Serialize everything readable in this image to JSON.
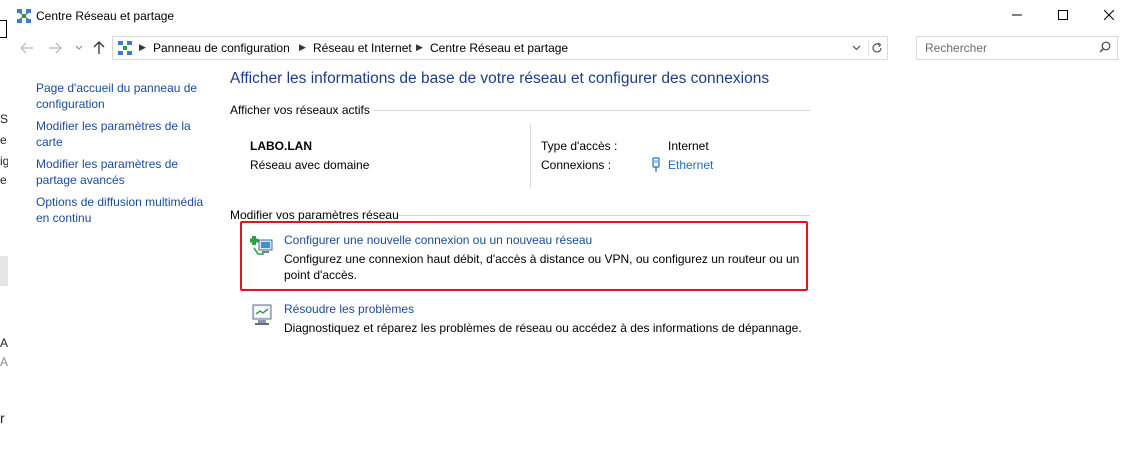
{
  "window": {
    "title": "Centre Réseau et partage",
    "min_icon": "minimize-icon",
    "max_icon": "maximize-icon",
    "close_icon": "close-icon"
  },
  "address": {
    "icon": "control-panel-icon",
    "crumbs": [
      "Panneau de configuration",
      "Réseau et Internet",
      "Centre Réseau et partage"
    ],
    "search_placeholder": "Rechercher"
  },
  "background_fragments": [
    "S",
    "e",
    "ig",
    "e",
    "A",
    "A",
    "r"
  ],
  "sidebar": {
    "items": [
      {
        "label": "Page d'accueil du panneau de configuration"
      },
      {
        "label": "Modifier les paramètres de la carte"
      },
      {
        "label": "Modifier les paramètres de partage avancés"
      },
      {
        "label": "Options de diffusion multimédia en continu"
      }
    ]
  },
  "main": {
    "heading": "Afficher les informations de base de votre réseau et configurer des connexions",
    "active_networks_title": "Afficher vos réseaux actifs",
    "network": {
      "name": "LABO.LAN",
      "category": "Réseau avec domaine",
      "access_label": "Type d'accès :",
      "access_value": "Internet",
      "connections_label": "Connexions :",
      "connections_value": "Ethernet"
    },
    "change_settings_title": "Modifier vos paramètres réseau",
    "tasks": [
      {
        "icon": "new-connection-icon",
        "link": "Configurer une nouvelle connexion ou un nouveau réseau",
        "desc": "Configurez une connexion haut débit, d'accès à distance ou VPN, ou configurez un routeur ou un point d'accès."
      },
      {
        "icon": "troubleshoot-icon",
        "link": "Résoudre les problèmes",
        "desc": "Diagnostiquez et réparez les problèmes de réseau ou accédez à des informations de dépannage."
      }
    ]
  },
  "colors": {
    "link": "#1a4b9a",
    "heading": "#1e3c8c",
    "highlight": "#e4141b"
  }
}
